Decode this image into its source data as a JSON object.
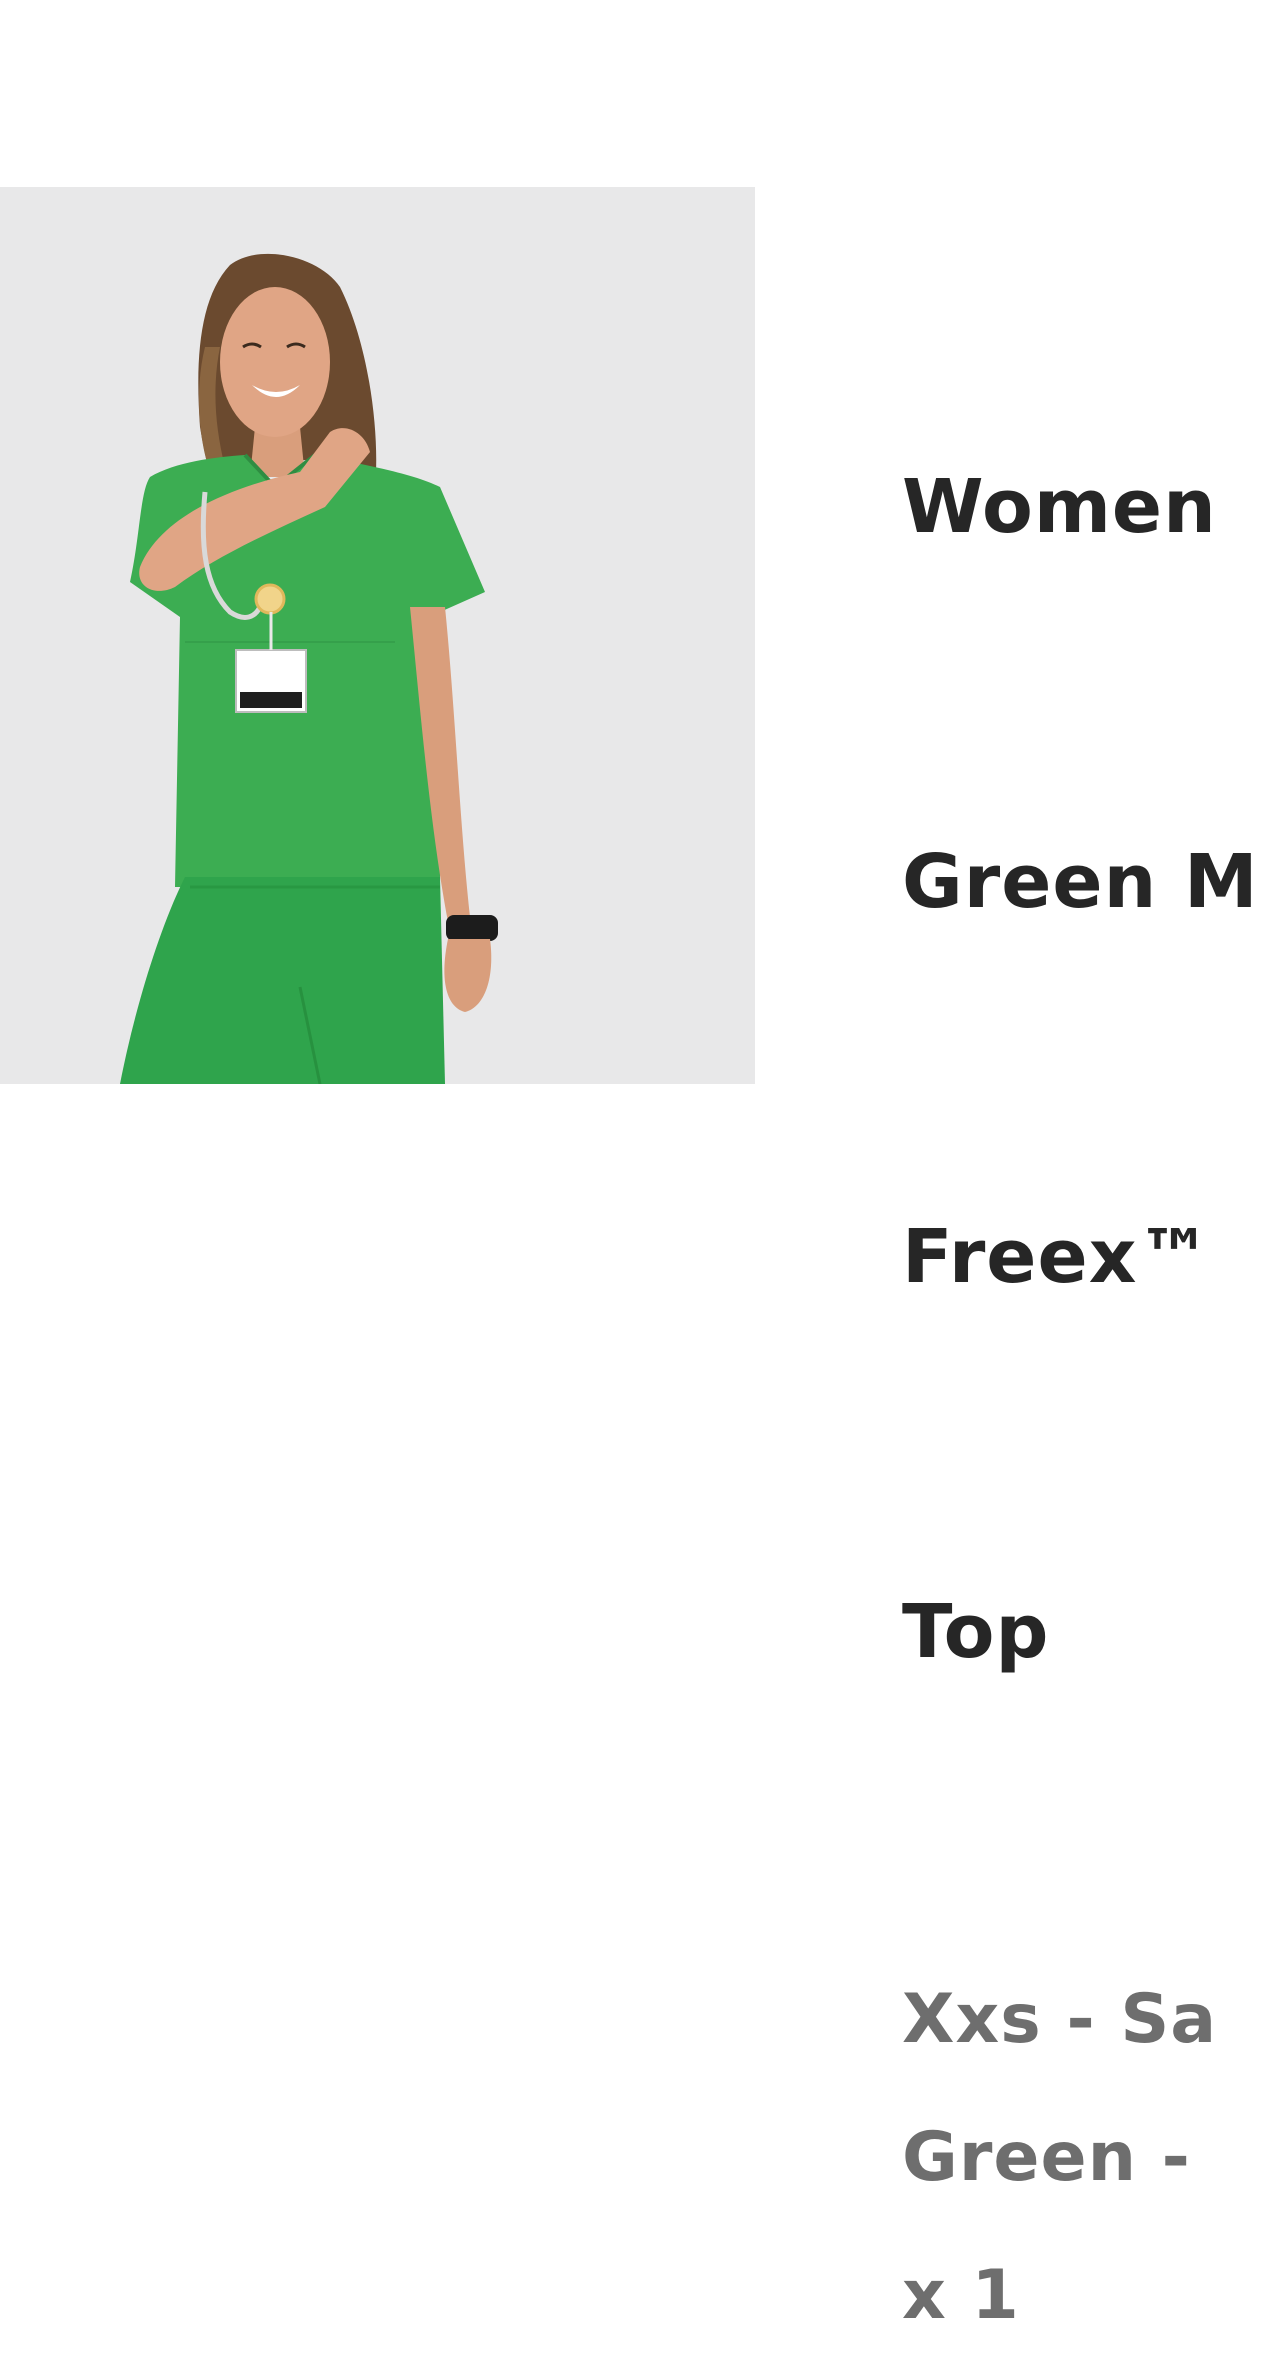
{
  "product": {
    "title_lines": [
      "Women",
      "Green M",
      "Freex™",
      "Top"
    ],
    "size_line": "Xxs - Sa",
    "color_line": "Green -",
    "quantity_line": "x 1"
  },
  "image": {
    "subject": "model-wearing-green-scrub-top",
    "background_color": "#e8e8e9",
    "garment_color": "#3cad52"
  },
  "colors": {
    "title_text": "#262626",
    "meta_text": "#6e6e6e",
    "page_background": "#ffffff"
  }
}
